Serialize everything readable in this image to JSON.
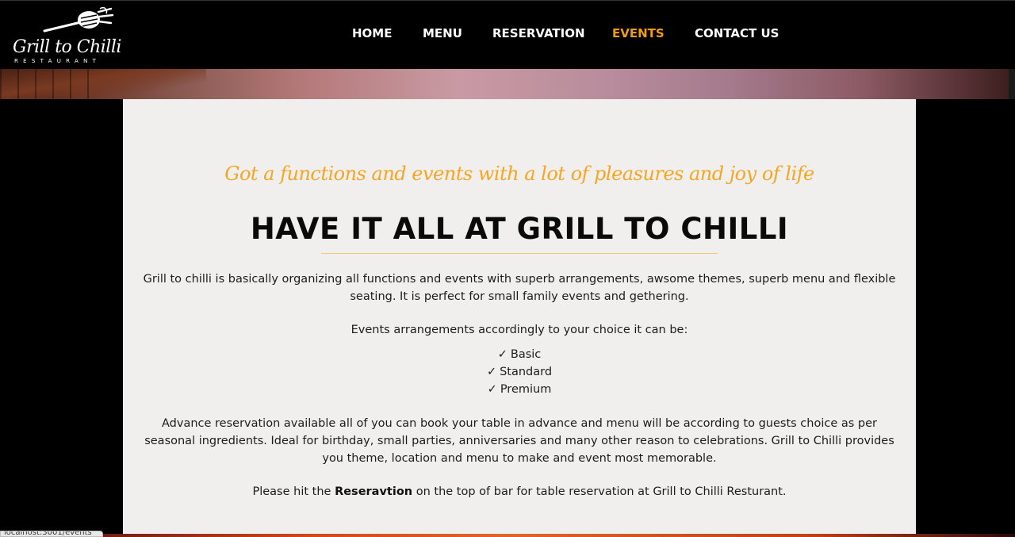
{
  "logo": {
    "title": "Grill to Chilli",
    "subtitle": "RESTAURANT"
  },
  "nav": {
    "items": [
      {
        "label": "HOME",
        "active": false
      },
      {
        "label": "MENU",
        "active": false
      },
      {
        "label": "RESERVATION",
        "active": false
      },
      {
        "label": "EVENTS",
        "active": true
      },
      {
        "label": "CONTACT US",
        "active": false
      }
    ]
  },
  "content": {
    "tagline": "Got a functions and events with a lot of pleasures and joy of life",
    "headline": "HAVE IT ALL AT GRILL TO CHILLI",
    "intro": "Grill to chilli is basically organizing all functions and events with superb arrangements, awsome themes, superb menu and flexible seating. It is perfect for small family events and gethering.",
    "arrangements_intro": "Events arrangements accordingly to your choice it can be:",
    "check_glyph": "✓",
    "options": [
      "Basic",
      "Standard",
      "Premium"
    ],
    "advance": "Advance reservation available all of you can book your table in advance and menu will be according to guests choice as per seasonal ingredients. Ideal for birthday, small parties, anniversaries and many other reason to celebrations. Grill to Chilli provides you theme, location and menu to make and event most memorable.",
    "cta_before": "Please hit the ",
    "cta_bold": "Reseravtion",
    "cta_after": " on the top of bar for table reservation at Grill to Chilli Resturant."
  },
  "statusbar": {
    "text": "localhost:3001/events"
  },
  "colors": {
    "accent": "#f39c12",
    "tagline": "#f5a623",
    "card_bg": "#f1efed",
    "header_bg": "#000000"
  }
}
